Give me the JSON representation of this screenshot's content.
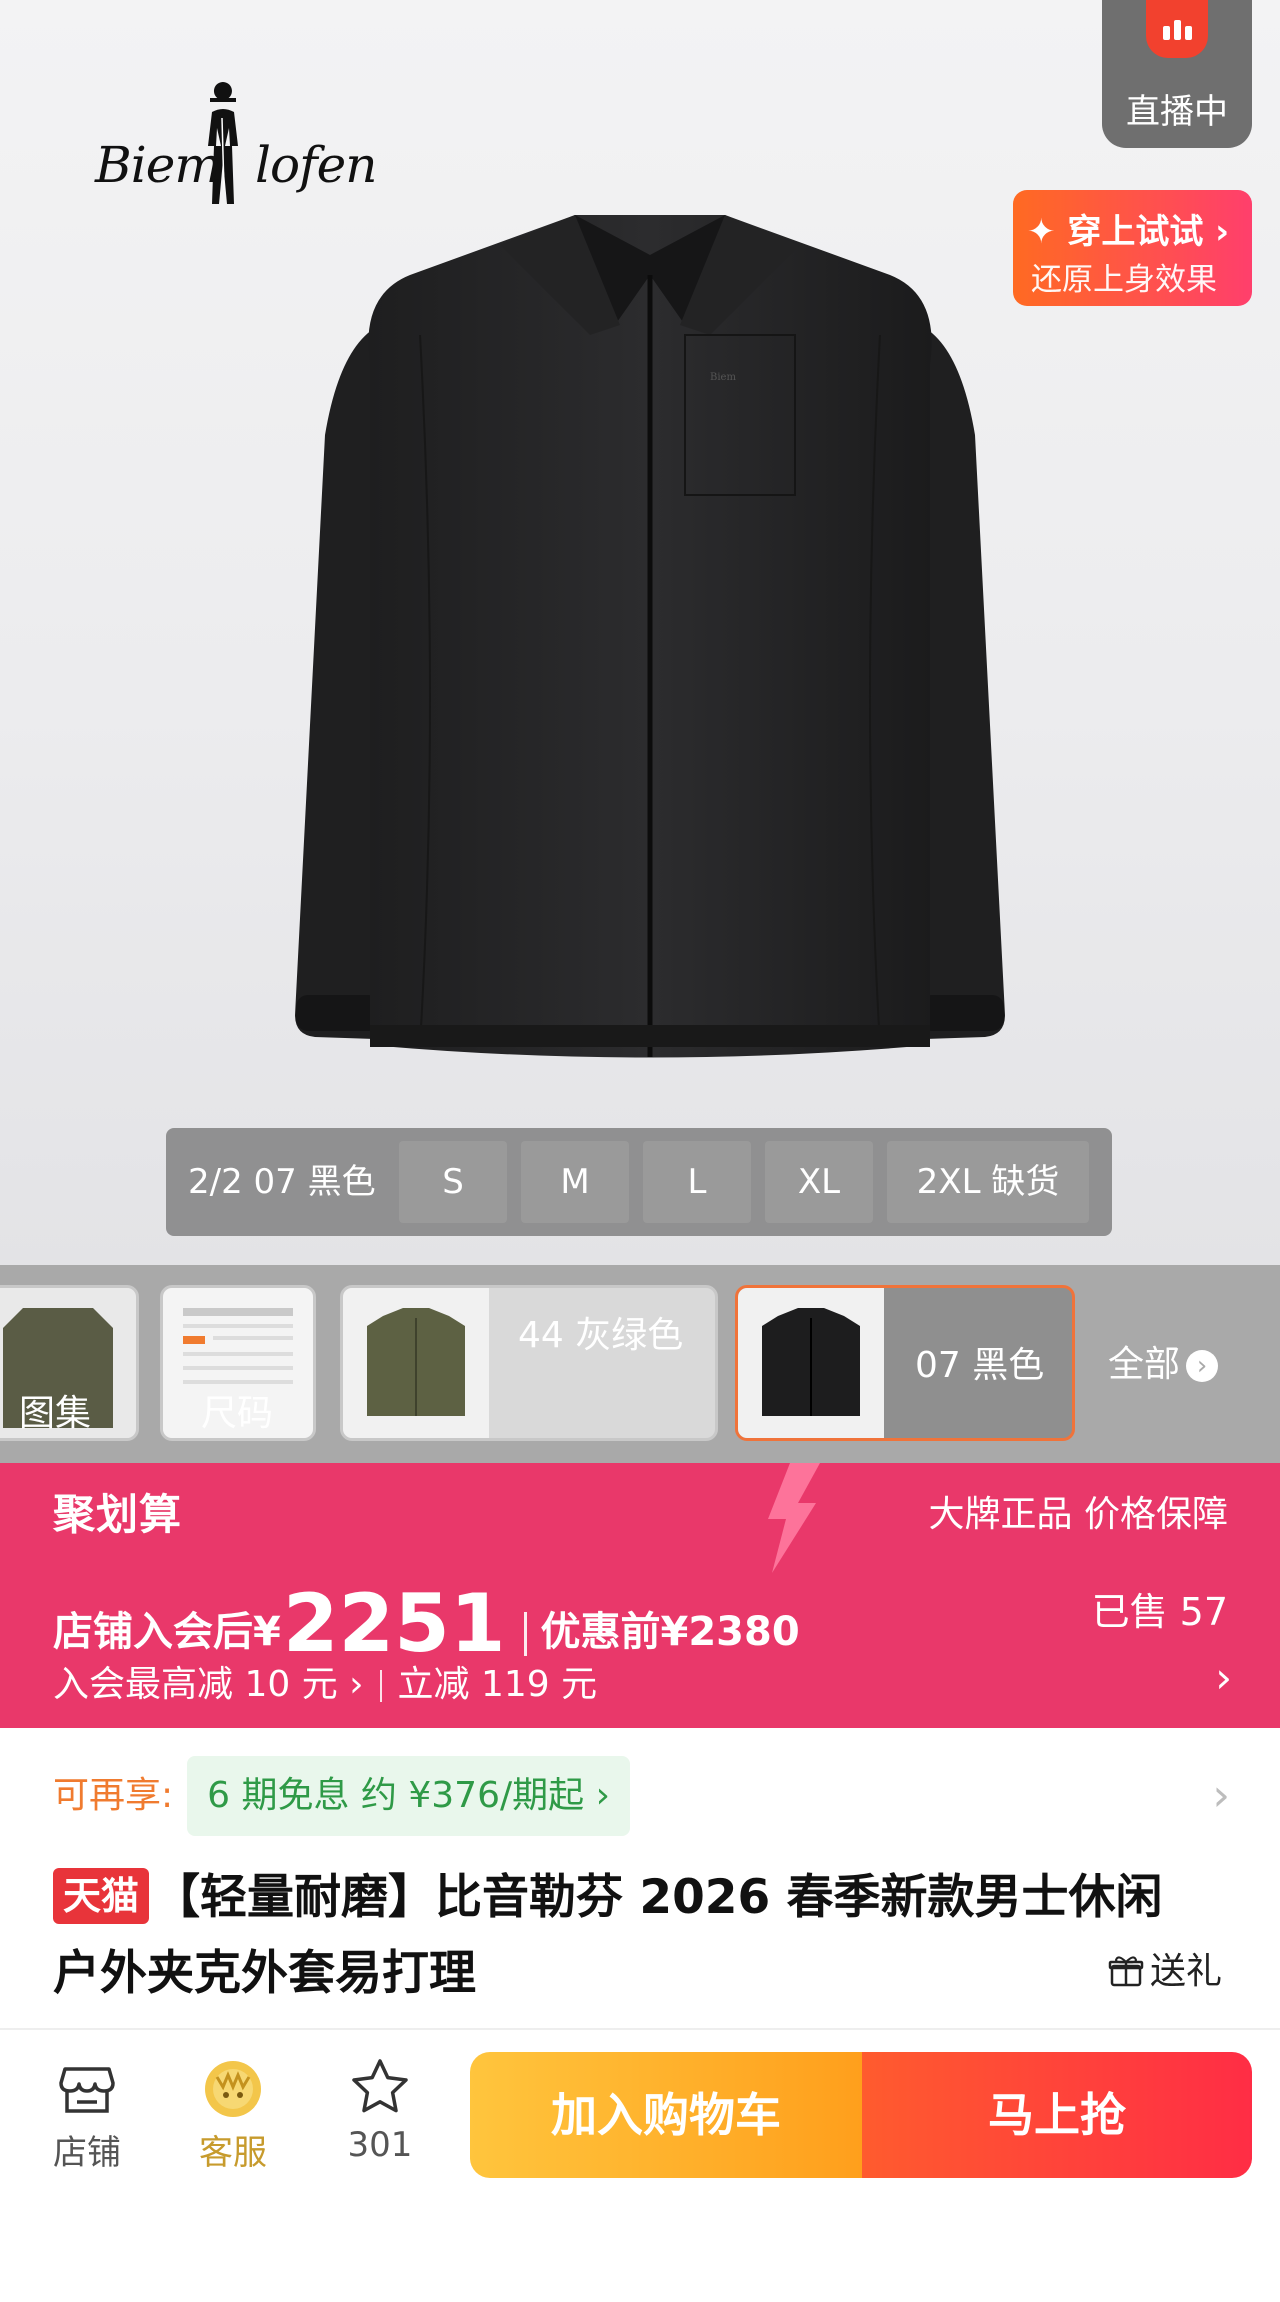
{
  "hero": {
    "brand": {
      "left": "Biem",
      "right": "lofen"
    },
    "live": {
      "label": "直播中"
    },
    "tryon": {
      "title": "✦ 穿上试试 ›",
      "subtitle": "还原上身效果"
    },
    "sizebar": {
      "label": "2/2 07 黑色",
      "sizes": [
        "S",
        "M",
        "L",
        "XL",
        "2XL 缺货"
      ]
    }
  },
  "thumbs": {
    "items": [
      {
        "label": "图集"
      },
      {
        "label": "尺码"
      },
      {
        "label": "44 灰绿色"
      },
      {
        "label": "07 黑色"
      }
    ],
    "all_label": "全部",
    "all_icon": "chevron-right-circle-icon"
  },
  "price": {
    "campaign": "聚划算",
    "guarantee": "大牌正品 价格保障",
    "member_prefix": "店铺入会后¥",
    "member_price": "2251",
    "original": "优惠前¥2380",
    "sold": "已售 57",
    "member_discount": "入会最高减 10 元 ›",
    "instant_discount": "立减 119 元",
    "color": "#e9386a"
  },
  "install": {
    "label": "可再享:",
    "offer": "6 期免息 约 ¥376/期起 ›"
  },
  "product": {
    "badge": "天猫",
    "title": "【轻量耐磨】比音勒芬 2026 春季新款男士休闲户外夹克外套易打理",
    "gift": "送礼"
  },
  "bottom": {
    "nav": [
      {
        "label": "店铺",
        "icon": "store-icon"
      },
      {
        "label": "客服",
        "icon": "customer-service-icon"
      },
      {
        "label": "301",
        "icon": "star-icon"
      }
    ],
    "add_cart": "加入购物车",
    "buy_now": "马上抢"
  }
}
